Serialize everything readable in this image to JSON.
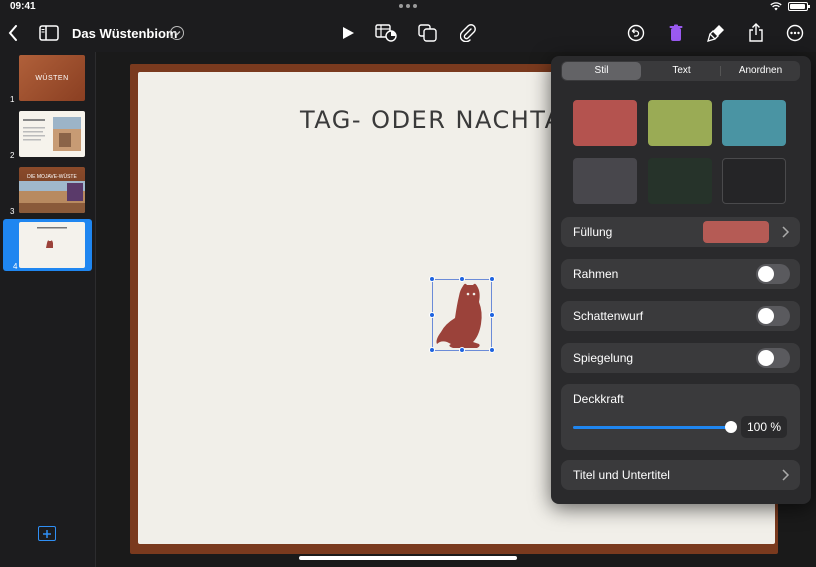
{
  "status_bar": {
    "time": "09:41"
  },
  "toolbar": {
    "document_title": "Das Wüstenbiom"
  },
  "sidebar": {
    "slides": [
      {
        "number": "1",
        "thumb_text": "WÜSTEN"
      },
      {
        "number": "2",
        "thumb_text": ""
      },
      {
        "number": "3",
        "thumb_text": "DIE MOJAVE-WÜSTE"
      },
      {
        "number": "4",
        "thumb_text": ""
      }
    ],
    "selected_index": 3
  },
  "slide": {
    "title": "TAG- ODER NACHTA"
  },
  "colors": {
    "accent": "#1f86f0",
    "slide_frame": "#7a3a1e",
    "owl": "#9b423a"
  },
  "format_panel": {
    "tabs": [
      "Stil",
      "Text",
      "Anordnen"
    ],
    "active_tab": "Stil",
    "swatches": [
      "#b4534f",
      "#9aab55",
      "#4a94a3",
      "#48474c",
      "#26332a",
      "#252527"
    ],
    "fill": {
      "label": "Füllung",
      "color": "#b55b55"
    },
    "border": {
      "label": "Rahmen",
      "on": false
    },
    "shadow": {
      "label": "Schattenwurf",
      "on": false
    },
    "reflection": {
      "label": "Spiegelung",
      "on": false
    },
    "opacity": {
      "label": "Deckkraft",
      "value_text": "100 %",
      "value": 1.0
    },
    "title_caption": {
      "label": "Titel und Untertitel"
    }
  }
}
